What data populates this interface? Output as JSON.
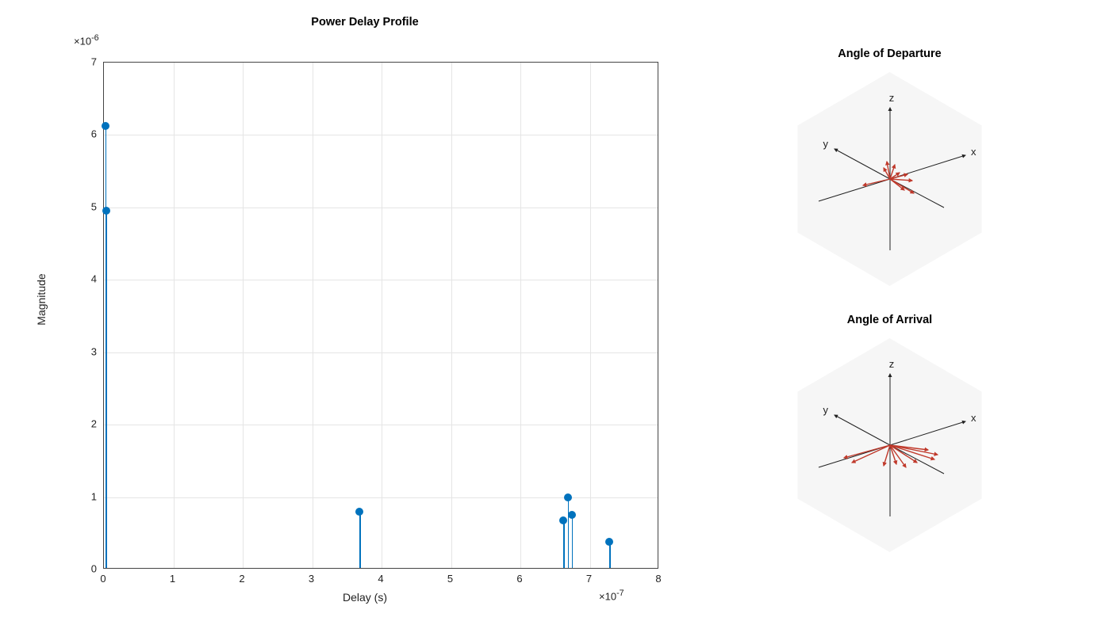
{
  "chart_data": {
    "type": "stem",
    "title": "Power Delay Profile",
    "xlabel": "Delay (s)",
    "ylabel": "Magnitude",
    "x_exponent_label": "×10",
    "x_exponent_sup": "-7",
    "y_exponent_label": "×10",
    "y_exponent_sup": "-6",
    "xlim": [
      0,
      8
    ],
    "ylim": [
      0,
      7
    ],
    "xticks": [
      0,
      1,
      2,
      3,
      4,
      5,
      6,
      7,
      8
    ],
    "xtick_labels": [
      "0",
      "1",
      "2",
      "3",
      "4",
      "5",
      "6",
      "7",
      "8"
    ],
    "yticks": [
      0,
      1,
      2,
      3,
      4,
      5,
      6,
      7
    ],
    "ytick_labels": [
      "0",
      "1",
      "2",
      "3",
      "4",
      "5",
      "6",
      "7"
    ],
    "points": [
      {
        "x": 0.02,
        "y": 6.12
      },
      {
        "x": 0.03,
        "y": 4.95
      },
      {
        "x": 3.68,
        "y": 0.8
      },
      {
        "x": 6.62,
        "y": 0.68
      },
      {
        "x": 6.68,
        "y": 1.0
      },
      {
        "x": 6.74,
        "y": 0.76
      },
      {
        "x": 7.28,
        "y": 0.38
      }
    ],
    "color": "#0072BD"
  },
  "angle_plots": [
    {
      "title": "Angle of Departure",
      "axis_labels": {
        "x": "x",
        "y": "y",
        "z": "z"
      },
      "vectors": [
        {
          "dx": 22,
          "dy": -6
        },
        {
          "dx": 28,
          "dy": 2
        },
        {
          "dx": -34,
          "dy": 8
        },
        {
          "dx": 6,
          "dy": -18
        },
        {
          "dx": -4,
          "dy": -22
        },
        {
          "dx": 12,
          "dy": -8
        },
        {
          "dx": 18,
          "dy": 14
        },
        {
          "dx": -8,
          "dy": -14
        },
        {
          "dx": 30,
          "dy": 18
        }
      ]
    },
    {
      "title": "Angle of Arrival",
      "axis_labels": {
        "x": "x",
        "y": "y",
        "z": "z"
      },
      "vectors": [
        {
          "dx": 60,
          "dy": 12
        },
        {
          "dx": 56,
          "dy": 18
        },
        {
          "dx": 48,
          "dy": 6
        },
        {
          "dx": -58,
          "dy": 16
        },
        {
          "dx": -48,
          "dy": 22
        },
        {
          "dx": 20,
          "dy": 28
        },
        {
          "dx": 8,
          "dy": 24
        },
        {
          "dx": -8,
          "dy": 26
        },
        {
          "dx": 34,
          "dy": 22
        }
      ]
    }
  ]
}
